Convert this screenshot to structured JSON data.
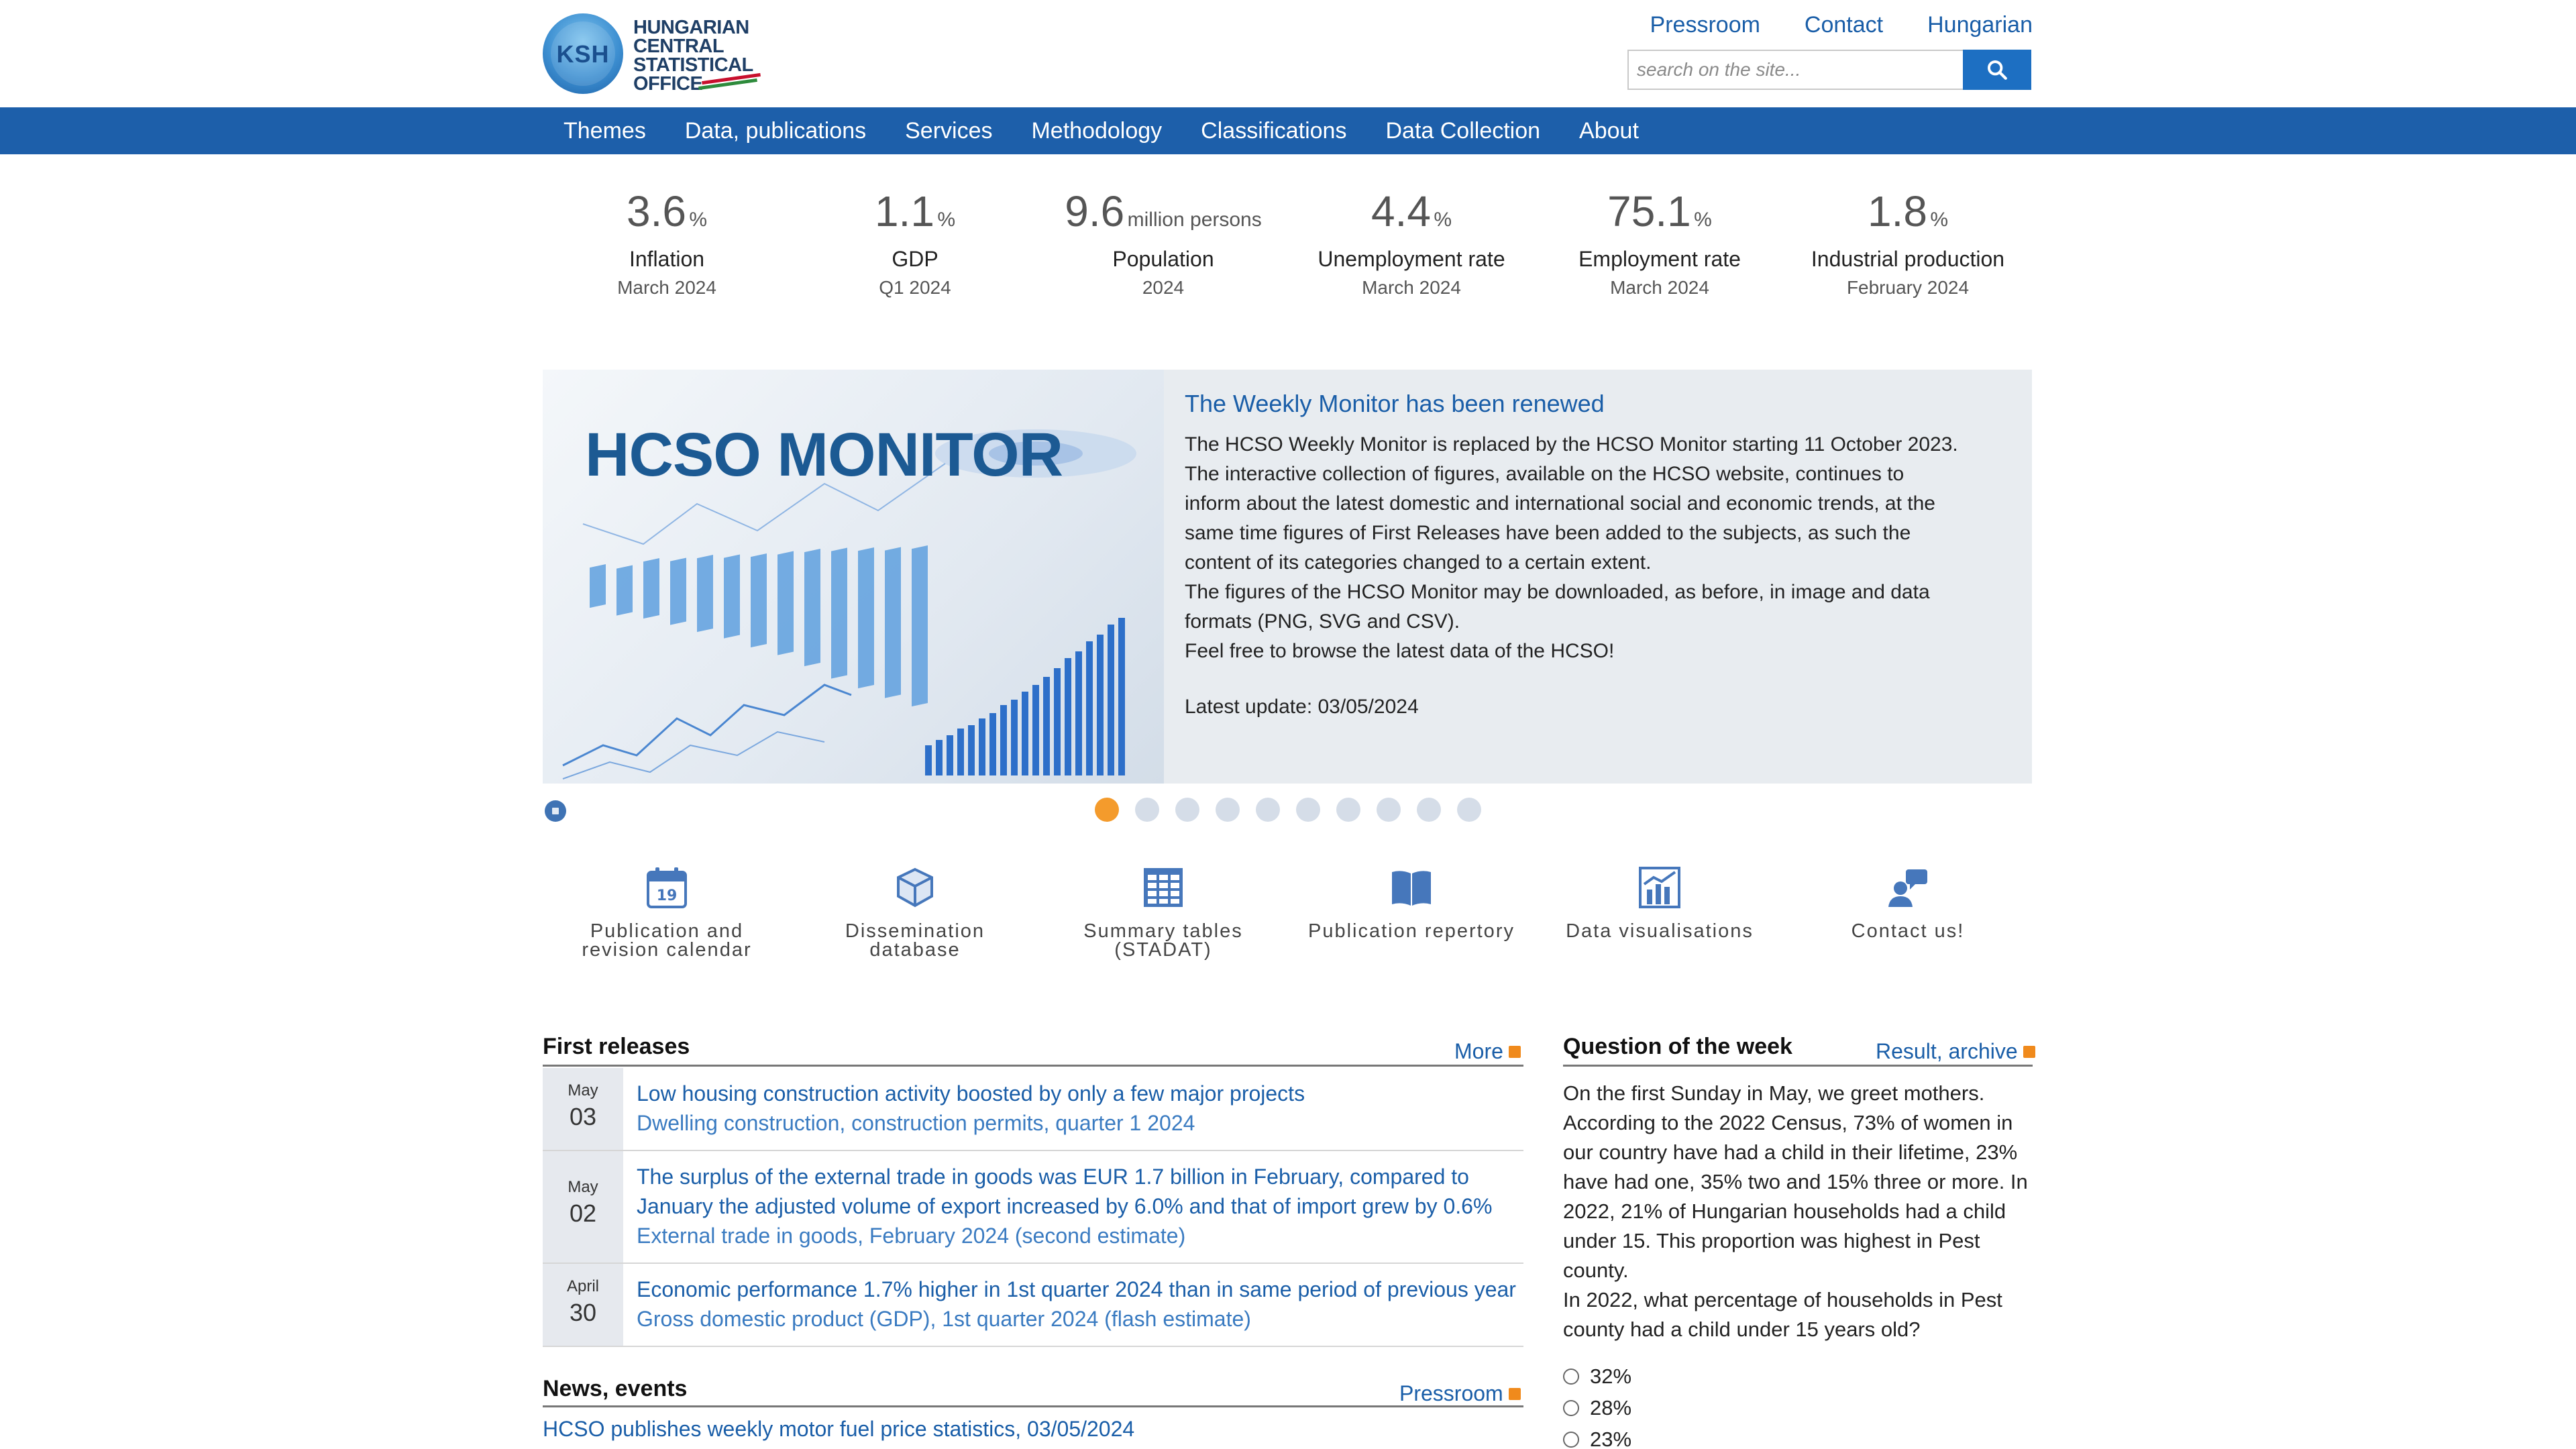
{
  "logo": {
    "abbr": "KSH",
    "line1": "HUNGARIAN",
    "line2": "CENTRAL",
    "line3": "STATISTICAL",
    "line4": "OFFICE"
  },
  "toplinks": [
    "Pressroom",
    "Contact",
    "Hungarian"
  ],
  "search": {
    "placeholder": "search on the site..."
  },
  "nav": [
    "Themes",
    "Data, publications",
    "Services",
    "Methodology",
    "Classifications",
    "Data Collection",
    "About"
  ],
  "stats": [
    {
      "value": "3.6",
      "unit": "%",
      "label": "Inflation",
      "date": "March 2024"
    },
    {
      "value": "1.1",
      "unit": "%",
      "label": "GDP",
      "date": "Q1 2024"
    },
    {
      "value": "9.6",
      "unit": "million persons",
      "label": "Population",
      "date": "2024"
    },
    {
      "value": "4.4",
      "unit": "%",
      "label": "Unemployment rate",
      "date": "March 2024"
    },
    {
      "value": "75.1",
      "unit": "%",
      "label": "Employment rate",
      "date": "March 2024"
    },
    {
      "value": "1.8",
      "unit": "%",
      "label": "Industrial production",
      "date": "February 2024"
    }
  ],
  "slider": {
    "image_title": "HCSO MONITOR",
    "heading": "The Weekly Monitor has been renewed",
    "paragraphs": [
      "The HCSO Weekly Monitor is replaced by the HCSO Monitor starting 11 October 2023.",
      "The interactive collection of figures, available on the HCSO website, continues to",
      "inform about the latest domestic and international social and economic trends, at the",
      "same time figures of First Releases have been added to the subjects, as such the",
      "content of its categories changed to a certain extent.",
      "The figures of the HCSO Monitor may be downloaded, as before, in image and data",
      "formats (PNG, SVG and CSV).",
      "Feel free to browse the latest data of the HCSO!"
    ],
    "update": "Latest update: 03/05/2024",
    "dot_count": 10,
    "active_dot": 0
  },
  "quick_links": [
    {
      "icon": "calendar-icon",
      "line1": "Publication and",
      "line2": "revision calendar"
    },
    {
      "icon": "cube-icon",
      "line1": "Dissemination",
      "line2": "database"
    },
    {
      "icon": "table-icon",
      "line1": "Summary tables",
      "line2": "(STADAT)"
    },
    {
      "icon": "book-icon",
      "line1": "Publication repertory",
      "line2": ""
    },
    {
      "icon": "chart-icon",
      "line1": "Data visualisations",
      "line2": ""
    },
    {
      "icon": "contact-icon",
      "line1": "Contact us!",
      "line2": ""
    }
  ],
  "first_releases": {
    "title": "First releases",
    "more": "More",
    "items": [
      {
        "month": "May",
        "day": "03",
        "title": "Low housing construction activity boosted by only a few major projects",
        "title2": "",
        "sub": "Dwelling construction, construction permits, quarter 1 2024"
      },
      {
        "month": "May",
        "day": "02",
        "title": "The surplus of the external trade in goods was EUR 1.7 billion in February, compared to",
        "title2": "January the adjusted volume of export increased by 6.0% and that of import grew by 0.6%",
        "sub": "External trade in goods, February 2024 (second estimate)"
      },
      {
        "month": "April",
        "day": "30",
        "title": "Economic performance 1.7% higher in 1st quarter 2024 than in same period of previous year",
        "title2": "",
        "sub": "Gross domestic product (GDP), 1st quarter 2024 (flash estimate)"
      }
    ]
  },
  "news": {
    "title": "News, events",
    "more": "Pressroom",
    "first_item": "HCSO publishes weekly motor fuel price statistics, 03/05/2024"
  },
  "question": {
    "title": "Question of the week",
    "more": "Result, archive",
    "lines": [
      "On the first Sunday in May, we greet mothers.",
      "According to the 2022 Census, 73% of women in",
      "our country have had a child in their lifetime, 23%",
      "have had one, 35% two and 15% three or more. In",
      "2022, 21% of Hungarian households had a child",
      "under 15. This proportion was highest in Pest",
      "county.",
      "In 2022, what percentage of households in Pest",
      "county had a child under 15 years old?"
    ],
    "answers": [
      "32%",
      "28%",
      "23%"
    ]
  },
  "colors": {
    "brand_blue": "#1d5faa",
    "link_blue": "#1a5ea8",
    "accent_orange": "#f49b2c"
  }
}
